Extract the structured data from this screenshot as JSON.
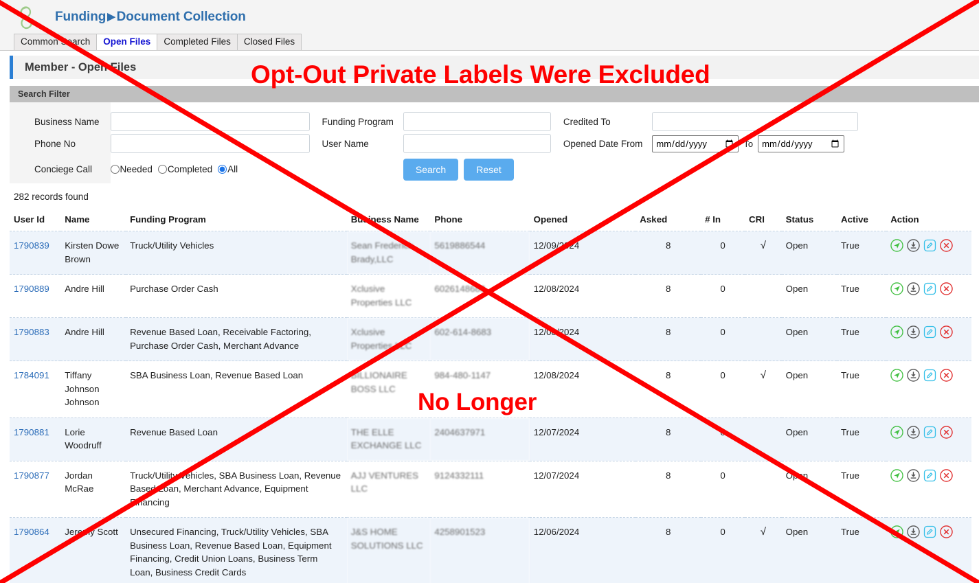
{
  "header": {
    "logo_icon": "leaf-logo-icon",
    "breadcrumb_root": "Funding",
    "breadcrumb_sep": "▶",
    "breadcrumb_current": "Document Collection",
    "accent_color": "#2f6fad"
  },
  "tabs": [
    {
      "label": "Common Search",
      "active": false
    },
    {
      "label": "Open Files",
      "active": true
    },
    {
      "label": "Completed Files",
      "active": false
    },
    {
      "label": "Closed Files",
      "active": false
    }
  ],
  "panel": {
    "title": "Member - Open Files",
    "accent_color": "#2b7fd4"
  },
  "search_filter": {
    "heading": "Search Filter",
    "heading_bg": "#bfbfbf",
    "fields": {
      "business_name_label": "Business Name",
      "business_name_value": "",
      "phone_no_label": "Phone No",
      "phone_no_value": "",
      "conciege_call_label": "Conciege Call",
      "funding_program_label": "Funding Program",
      "funding_program_value": "",
      "user_name_label": "User Name",
      "user_name_value": "",
      "credited_to_label": "Credited To",
      "credited_to_value": "",
      "opened_date_from_label": "Opened Date From",
      "opened_date_from_value": "",
      "opened_date_from_placeholder": "mm/dd/yyy",
      "date_to_word": "To",
      "opened_date_to_value": "",
      "opened_date_to_placeholder": "mm/dd/yyy"
    },
    "radios": [
      {
        "label": "Needed",
        "checked": false
      },
      {
        "label": "Completed",
        "checked": false
      },
      {
        "label": "All",
        "checked": true
      }
    ],
    "buttons": {
      "search_label": "Search",
      "reset_label": "Reset",
      "color": "#5aabee"
    }
  },
  "results": {
    "records_found": "282 records found"
  },
  "table": {
    "columns": [
      "User Id",
      "Name",
      "Funding Program",
      "Business Name",
      "Phone",
      "Opened",
      "Asked",
      "# In",
      "CRI",
      "Status",
      "Active",
      "Action"
    ],
    "action_icons": [
      "send-icon",
      "download-icon",
      "edit-icon",
      "cancel-icon"
    ],
    "rows": [
      {
        "user_id": "1790839",
        "name": "Kirsten Dowe Brown",
        "funding_program": "Truck/Utility Vehicles",
        "business_name": "Sean Frederick Brady,LLC",
        "phone": "5619886544",
        "opened": "12/09/2024",
        "asked": "8",
        "num_in": "0",
        "cri": "√",
        "status": "Open",
        "active": "True"
      },
      {
        "user_id": "1790889",
        "name": "Andre Hill",
        "funding_program": "Purchase Order Cash",
        "business_name": "Xclusive Properties LLC",
        "phone": "6026148683",
        "opened": "12/08/2024",
        "asked": "8",
        "num_in": "0",
        "cri": "",
        "status": "Open",
        "active": "True"
      },
      {
        "user_id": "1790883",
        "name": "Andre Hill",
        "funding_program": "Revenue Based Loan, Receivable Factoring, Purchase Order Cash, Merchant Advance",
        "business_name": "Xclusive Properties LLC",
        "phone": "602-614-8683",
        "opened": "12/08/2024",
        "asked": "8",
        "num_in": "0",
        "cri": "",
        "status": "Open",
        "active": "True"
      },
      {
        "user_id": "1784091",
        "name": "Tiffany Johnson Johnson",
        "funding_program": "SBA Business Loan, Revenue Based Loan",
        "business_name": "BILLIONAIRE BOSS LLC",
        "phone": "984-480-1147",
        "opened": "12/08/2024",
        "asked": "8",
        "num_in": "0",
        "cri": "√",
        "status": "Open",
        "active": "True"
      },
      {
        "user_id": "1790881",
        "name": "Lorie Woodruff",
        "funding_program": "Revenue Based Loan",
        "business_name": "THE ELLE EXCHANGE LLC",
        "phone": "2404637971",
        "opened": "12/07/2024",
        "asked": "8",
        "num_in": "0",
        "cri": "",
        "status": "Open",
        "active": "True"
      },
      {
        "user_id": "1790877",
        "name": "Jordan McRae",
        "funding_program": "Truck/Utility Vehicles, SBA Business Loan, Revenue Based Loan, Merchant Advance, Equipment Financing",
        "business_name": "AJJ VENTURES LLC",
        "phone": "9124332111",
        "opened": "12/07/2024",
        "asked": "8",
        "num_in": "0",
        "cri": "",
        "status": "Open",
        "active": "True"
      },
      {
        "user_id": "1790864",
        "name": "Jeremy Scott",
        "funding_program": "Unsecured Financing, Truck/Utility Vehicles, SBA Business Loan, Revenue Based Loan, Equipment Financing, Credit Union Loans, Business Term Loan, Business Credit Cards",
        "business_name": "J&S HOME SOLUTIONS LLC",
        "phone": "4258901523",
        "opened": "12/06/2024",
        "asked": "8",
        "num_in": "0",
        "cri": "√",
        "status": "Open",
        "active": "True"
      }
    ]
  },
  "annotations": {
    "color": "#fe0000",
    "main_text": "Opt-Out Private Labels Were Excluded",
    "sub_text": "No Longer",
    "cross_out": "red-diagonal-cross"
  }
}
